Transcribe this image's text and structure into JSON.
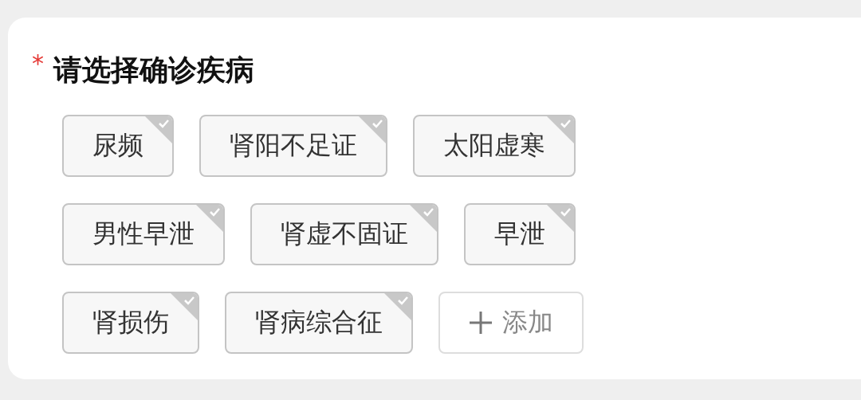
{
  "form": {
    "required_mark": "*",
    "title": "请选择确诊疾病",
    "tags": [
      {
        "label": "尿频",
        "selected": true
      },
      {
        "label": "肾阳不足证",
        "selected": true
      },
      {
        "label": "太阳虚寒",
        "selected": true
      },
      {
        "label": "男性早泄",
        "selected": true
      },
      {
        "label": "肾虚不固证",
        "selected": true
      },
      {
        "label": "早泄",
        "selected": true
      },
      {
        "label": "肾损伤",
        "selected": true
      },
      {
        "label": "肾病综合征",
        "selected": true
      }
    ],
    "add_button": {
      "label": "添加"
    }
  }
}
